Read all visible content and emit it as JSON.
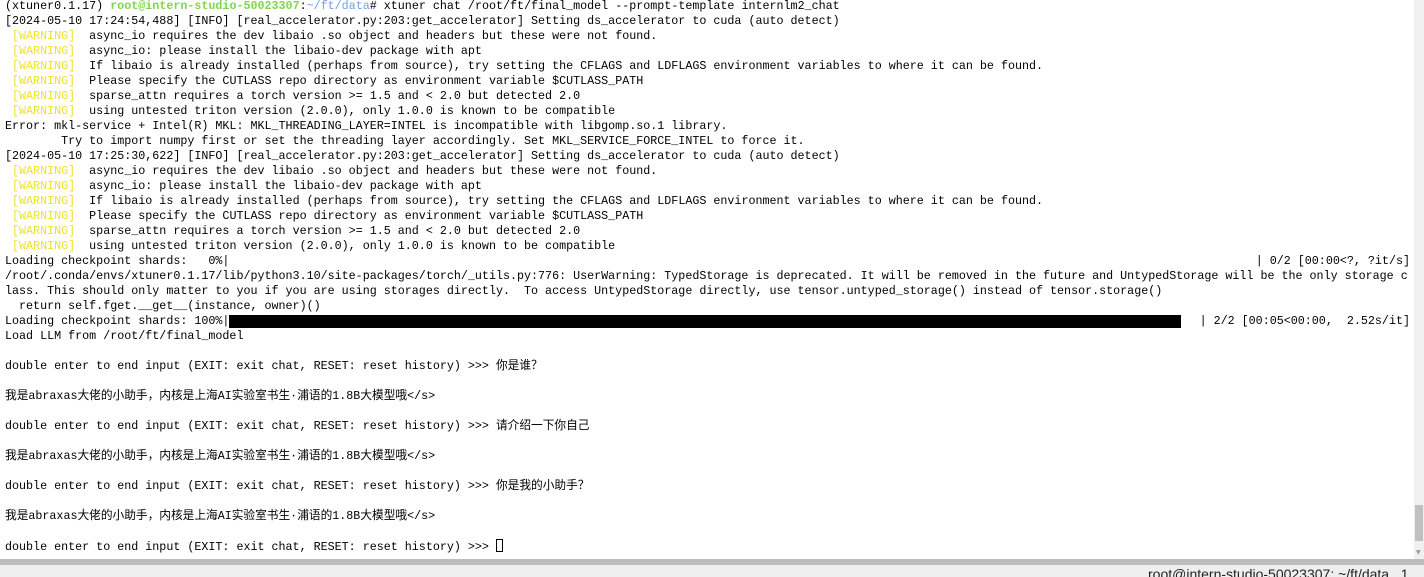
{
  "terminal": {
    "lines": [
      [
        {
          "t": "(xtuner0.1.17) "
        },
        {
          "t": "root@intern-studio-50023307",
          "c": "prompt"
        },
        {
          "t": ":"
        },
        {
          "t": "~/ft/data",
          "c": "path"
        },
        {
          "t": "# xtuner chat /root/ft/final_model --prompt-template internlm2_chat"
        }
      ],
      [
        {
          "t": "[2024-05-10 17:24:54,488] [INFO] [real_accelerator.py:203:get_accelerator] Setting ds_accelerator to cuda (auto detect)"
        }
      ],
      [
        {
          "t": " [WARNING] ",
          "c": "warn"
        },
        {
          "t": " async_io requires the dev libaio .so object and headers but these were not found."
        }
      ],
      [
        {
          "t": " [WARNING] ",
          "c": "warn"
        },
        {
          "t": " async_io: please install the libaio-dev package with apt"
        }
      ],
      [
        {
          "t": " [WARNING] ",
          "c": "warn"
        },
        {
          "t": " If libaio is already installed (perhaps from source), try setting the CFLAGS and LDFLAGS environment variables to where it can be found."
        }
      ],
      [
        {
          "t": " [WARNING] ",
          "c": "warn"
        },
        {
          "t": " Please specify the CUTLASS repo directory as environment variable $CUTLASS_PATH"
        }
      ],
      [
        {
          "t": " [WARNING] ",
          "c": "warn"
        },
        {
          "t": " sparse_attn requires a torch version >= 1.5 and < 2.0 but detected 2.0"
        }
      ],
      [
        {
          "t": " [WARNING] ",
          "c": "warn"
        },
        {
          "t": " using untested triton version (2.0.0), only 1.0.0 is known to be compatible"
        }
      ],
      [
        {
          "t": "Error: mkl-service + Intel(R) MKL: MKL_THREADING_LAYER=INTEL is incompatible with libgomp.so.1 library."
        }
      ],
      [
        {
          "t": "        Try to import numpy first or set the threading layer accordingly. Set MKL_SERVICE_FORCE_INTEL to force it."
        }
      ],
      [
        {
          "t": "[2024-05-10 17:25:30,622] [INFO] [real_accelerator.py:203:get_accelerator] Setting ds_accelerator to cuda (auto detect)"
        }
      ],
      [
        {
          "t": " [WARNING] ",
          "c": "warn"
        },
        {
          "t": " async_io requires the dev libaio .so object and headers but these were not found."
        }
      ],
      [
        {
          "t": " [WARNING] ",
          "c": "warn"
        },
        {
          "t": " async_io: please install the libaio-dev package with apt"
        }
      ],
      [
        {
          "t": " [WARNING] ",
          "c": "warn"
        },
        {
          "t": " If libaio is already installed (perhaps from source), try setting the CFLAGS and LDFLAGS environment variables to where it can be found."
        }
      ],
      [
        {
          "t": " [WARNING] ",
          "c": "warn"
        },
        {
          "t": " Please specify the CUTLASS repo directory as environment variable $CUTLASS_PATH"
        }
      ],
      [
        {
          "t": " [WARNING] ",
          "c": "warn"
        },
        {
          "t": " sparse_attn requires a torch version >= 1.5 and < 2.0 but detected 2.0"
        }
      ],
      [
        {
          "t": " [WARNING] ",
          "c": "warn"
        },
        {
          "t": " using untested triton version (2.0.0), only 1.0.0 is known to be compatible"
        }
      ],
      {
        "progress": {
          "label": "Loading checkpoint shards:   0%|",
          "fraction": 0,
          "right": "| 0/2 [00:00<?, ?it/s]"
        }
      },
      [
        {
          "t": "/root/.conda/envs/xtuner0.1.17/lib/python3.10/site-packages/torch/_utils.py:776: UserWarning: TypedStorage is deprecated. It will be removed in the future and UntypedStorage will be the only storage c"
        }
      ],
      [
        {
          "t": "lass. This should only matter to you if you are using storages directly.  To access UntypedStorage directly, use tensor.untyped_storage() instead of tensor.storage()"
        }
      ],
      [
        {
          "t": "  return self.fget.__get__(instance, owner)()"
        }
      ],
      {
        "progress": {
          "label": "Loading checkpoint shards: 100%|",
          "fraction": 1,
          "right": "| 2/2 [00:05<00:00,  2.52s/it]"
        }
      },
      [
        {
          "t": "Load LLM from /root/ft/final_model"
        }
      ],
      [],
      [
        {
          "t": "double enter to end input (EXIT: exit chat, RESET: reset history) >>> 你是谁？"
        }
      ],
      [],
      [
        {
          "t": "我是abraxas大佬的小助手，内核是上海AI实验室书生·浦语的1.8B大模型哦</s>"
        }
      ],
      [],
      [
        {
          "t": "double enter to end input (EXIT: exit chat, RESET: reset history) >>> 请介绍一下你自己"
        }
      ],
      [],
      [
        {
          "t": "我是abraxas大佬的小助手，内核是上海AI实验室书生·浦语的1.8B大模型哦</s>"
        }
      ],
      [],
      [
        {
          "t": "double enter to end input (EXIT: exit chat, RESET: reset history) >>> 你是我的小助手？"
        }
      ],
      [],
      [
        {
          "t": "我是abraxas大佬的小助手，内核是上海AI实验室书生·浦语的1.8B大模型哦</s>"
        }
      ],
      [],
      [
        {
          "t": "double enter to end input (EXIT: exit chat, RESET: reset history) >>> "
        },
        {
          "cursor": true
        }
      ]
    ]
  },
  "status_bar": {
    "text": "root@intern-studio-50023307: ~/ft/data   1"
  },
  "colors": {
    "prompt": "#7ed84a",
    "path": "#6fa0e8",
    "warning": "#f0e030"
  }
}
